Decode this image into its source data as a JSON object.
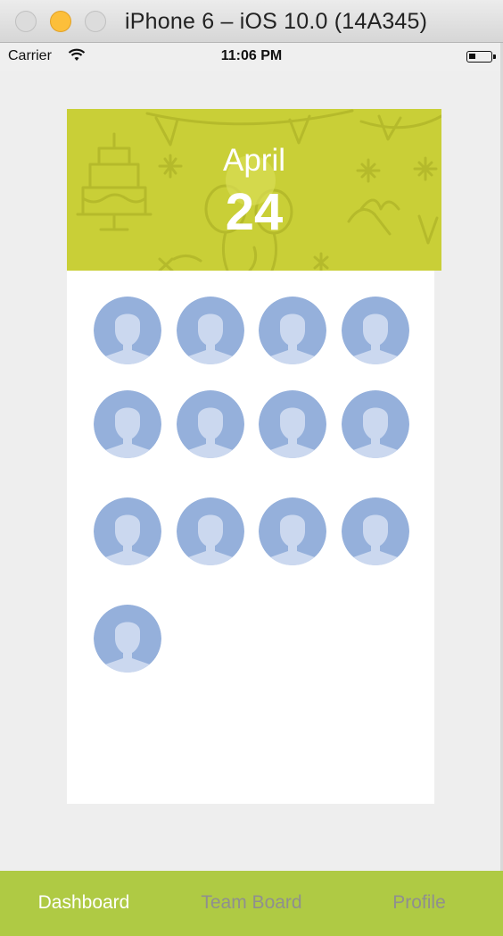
{
  "window": {
    "title": "iPhone 6 – iOS 10.0 (14A345)"
  },
  "status_bar": {
    "carrier": "Carrier",
    "time": "11:06 PM"
  },
  "banner": {
    "month": "April",
    "day": "24"
  },
  "avatars": {
    "count": 13,
    "icon": "person-placeholder-icon"
  },
  "tabs": [
    {
      "label": "Dashboard",
      "active": true
    },
    {
      "label": "Team Board",
      "active": false
    },
    {
      "label": "Profile",
      "active": false
    }
  ],
  "colors": {
    "banner": "#c9cf37",
    "tabbar": "#afca44",
    "avatar_bg": "#95b0db",
    "avatar_fg": "#cbd8ef"
  }
}
